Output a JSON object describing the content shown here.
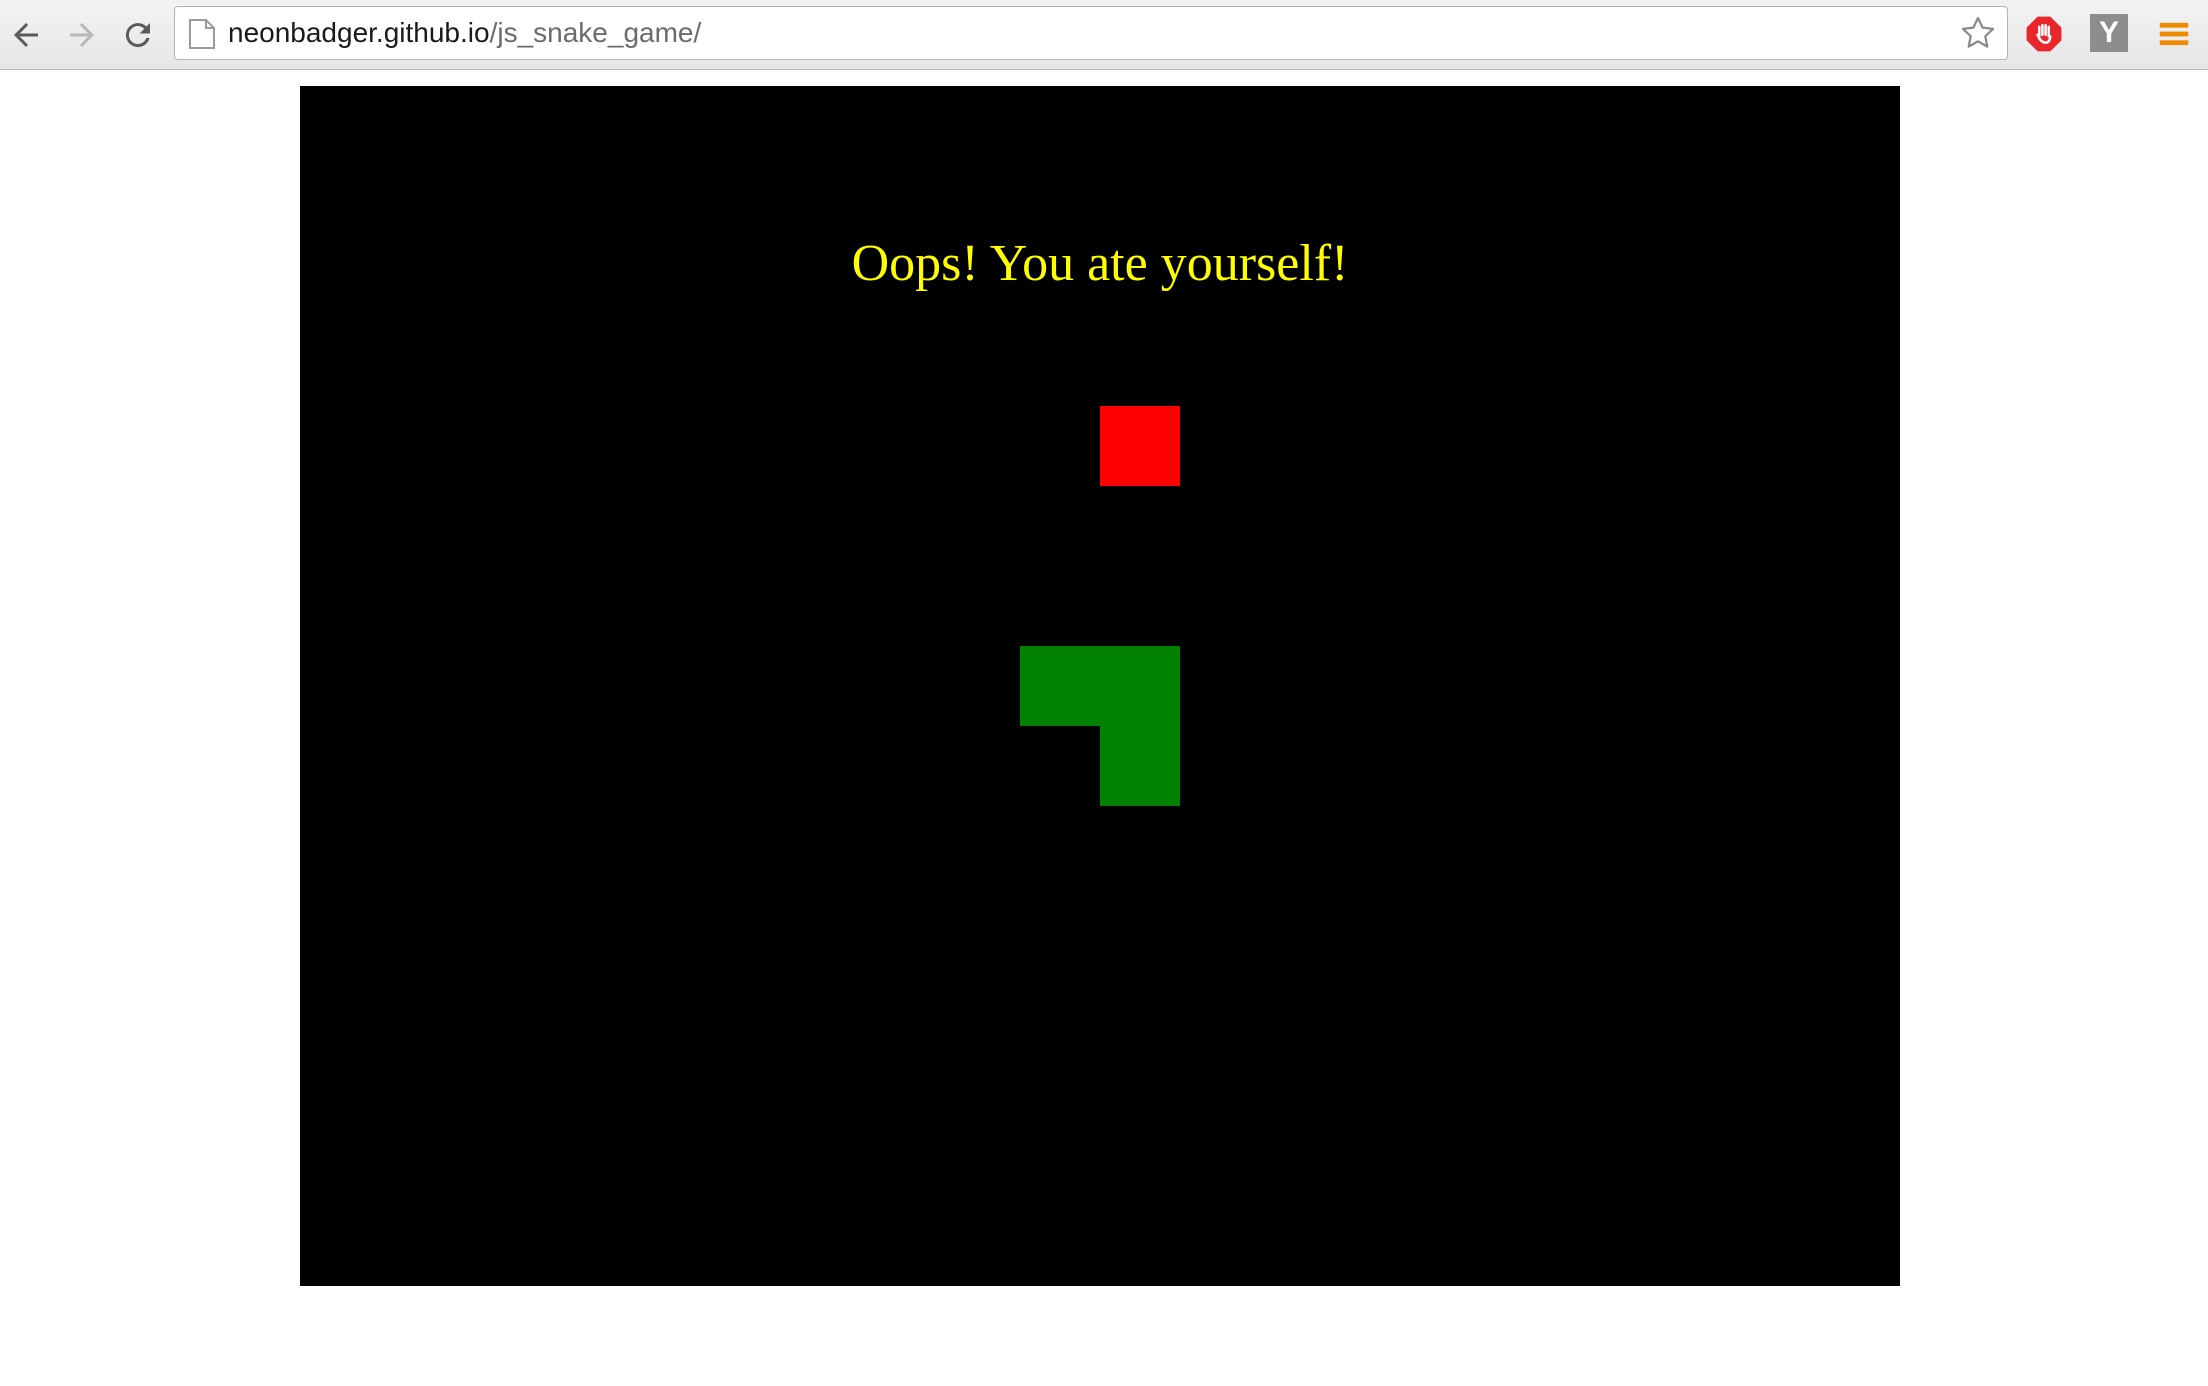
{
  "browser": {
    "url_host": "neonbadger.github.io",
    "url_path": "/js_snake_game/"
  },
  "game": {
    "message": "Oops! You ate yourself!",
    "colors": {
      "background": "#000000",
      "message": "#ffff00",
      "food": "#ff0000",
      "snake": "#008000"
    }
  },
  "icons": {
    "back": "arrow-left-icon",
    "forward": "arrow-right-icon",
    "reload": "reload-icon",
    "page": "page-icon",
    "bookmark": "star-icon",
    "adblock": "stop-hand-icon",
    "y_extension": "y-icon",
    "menu": "hamburger-menu-icon"
  },
  "extensions": {
    "y_label": "Y"
  }
}
